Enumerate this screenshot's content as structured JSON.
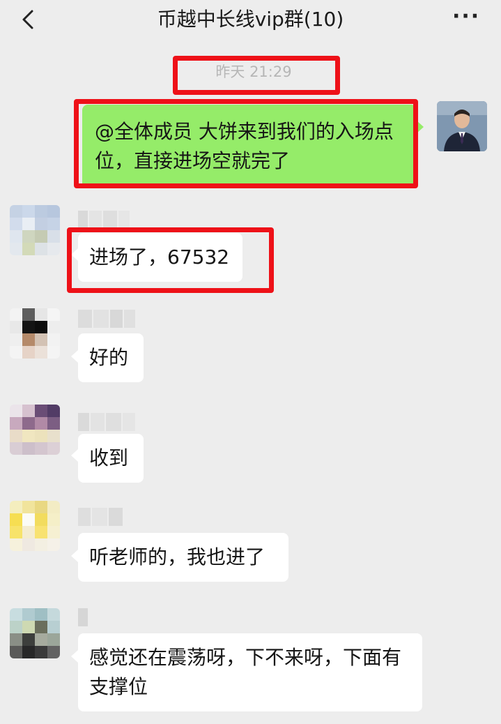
{
  "header": {
    "title": "币越中长线vip群(10)",
    "back_icon": "chevron-left-icon",
    "more_icon": "more-dots-icon",
    "more_glyph": "···"
  },
  "timestamp": "昨天 21:29",
  "colors": {
    "background": "#ededed",
    "my_bubble": "#95ec69",
    "other_bubble": "#ffffff",
    "highlight_box": "#ee1118",
    "timestamp_text": "#b6b6b6"
  },
  "messages": [
    {
      "sender": "me",
      "text": "@全体成员 大饼来到我们的入场点位，直接进场空就完了"
    },
    {
      "sender": "other",
      "sender_name": "",
      "text": "进场了，67532"
    },
    {
      "sender": "other",
      "sender_name": "",
      "text": "好的"
    },
    {
      "sender": "other",
      "sender_name": "",
      "text": "收到"
    },
    {
      "sender": "other",
      "sender_name": "",
      "text": "听老师的，我也进了"
    },
    {
      "sender": "other",
      "sender_name": "",
      "text": "感觉还在震荡呀，下不来呀，下面有支撑位"
    }
  ]
}
